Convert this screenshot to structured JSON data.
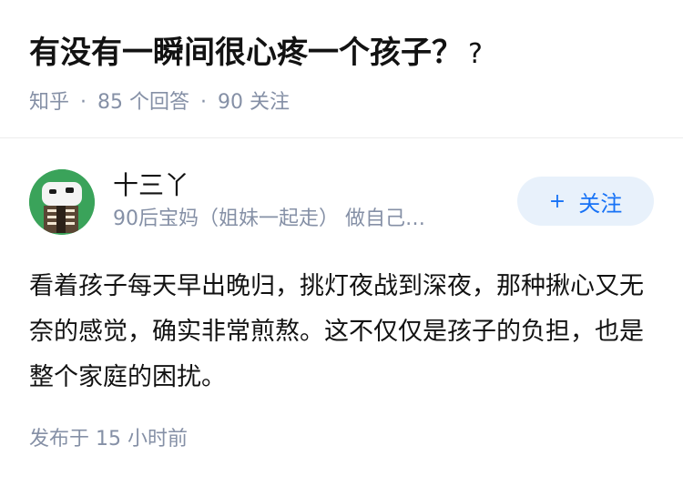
{
  "question": {
    "title": "有没有一瞬间很心疼一个孩子？",
    "title_suffix": "?",
    "source": "知乎",
    "answers_count": "85 个回答",
    "followers_count": "90 关注"
  },
  "answer": {
    "author_name": "十三丫",
    "author_bio": "90后宝妈（姐妹一起走） 做自己…",
    "follow_label": "关注",
    "follow_icon": "plus-icon",
    "content": "看着孩子每天早出晚归，挑灯夜战到深夜，那种揪心又无奈的感觉，确实非常煎熬。这不仅仅是孩子的负担，也是整个家庭的困扰。",
    "time": "发布于 15 小时前"
  },
  "colors": {
    "meta": "#8590a6",
    "accent": "#1772f6",
    "follow_bg": "#e8f1fb",
    "avatar_bg": "#3aa35a"
  }
}
